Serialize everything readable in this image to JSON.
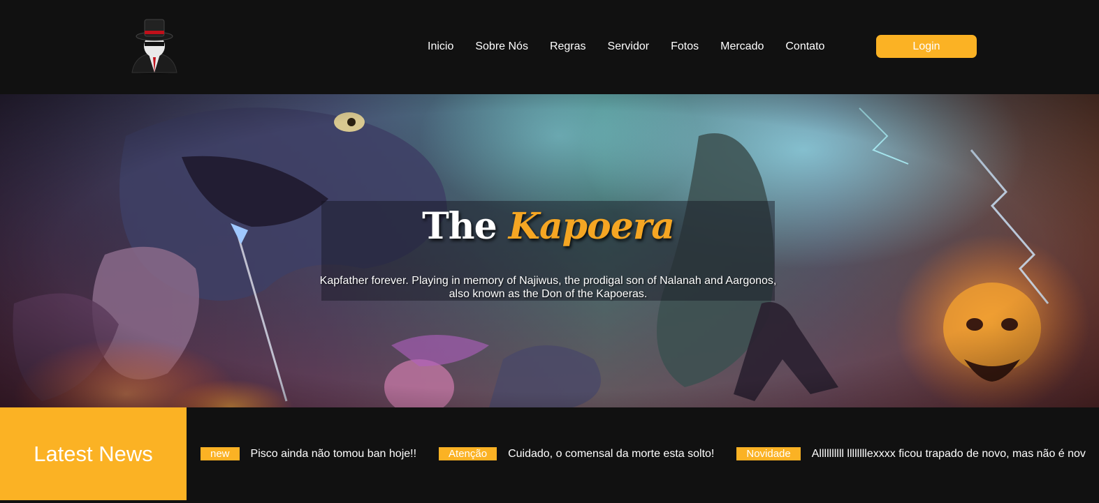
{
  "brand": {
    "logo_icon": "mafia-gentleman-icon"
  },
  "nav": {
    "items": [
      {
        "label": "Inicio"
      },
      {
        "label": "Sobre Nós"
      },
      {
        "label": "Regras"
      },
      {
        "label": "Servidor"
      },
      {
        "label": "Fotos"
      },
      {
        "label": "Mercado"
      },
      {
        "label": "Contato"
      }
    ],
    "login_label": "Login"
  },
  "hero": {
    "title_part1": "The",
    "title_part2": "Kapoera",
    "subtitle_line1": "Kapfather forever. Playing in memory of Najiwus, the prodigal son of Nalanah and Aargonos,",
    "subtitle_line2": "also known as the Don of the Kapoeras."
  },
  "news": {
    "label": "Latest News",
    "items": [
      {
        "tag": "new",
        "text": "Pisco ainda não tomou ban hoje!!"
      },
      {
        "tag": "Atenção",
        "text": "Cuidado, o comensal da morte esta solto!"
      },
      {
        "tag": "Novidade",
        "text": "Allllllllll llllllllexxxx ficou trapado de novo, mas não é nov"
      }
    ]
  },
  "colors": {
    "accent": "#fbb224",
    "background": "#111111"
  }
}
